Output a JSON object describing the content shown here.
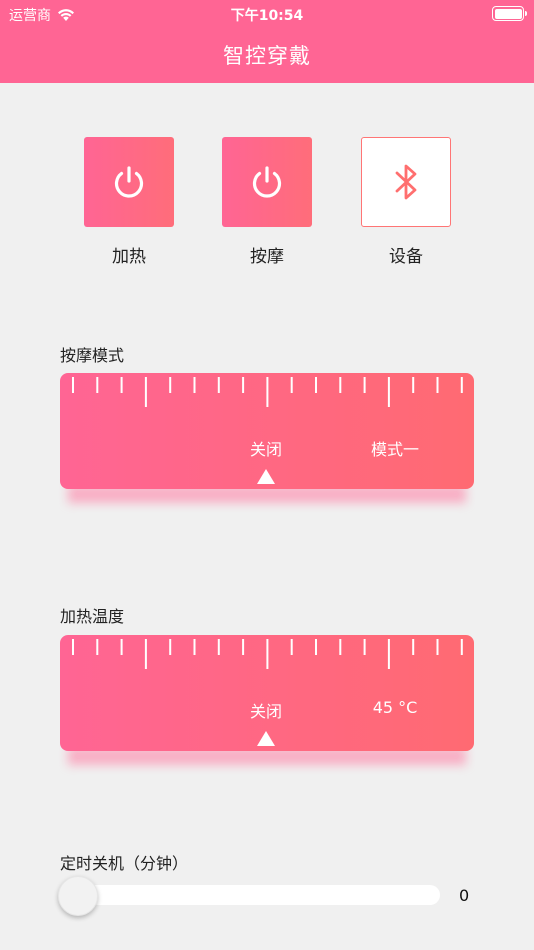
{
  "status_bar": {
    "carrier": "运营商",
    "time": "下午10:54"
  },
  "nav": {
    "title": "智控穿戴"
  },
  "toggles": [
    {
      "label": "加热",
      "icon": "power-icon"
    },
    {
      "label": "按摩",
      "icon": "power-icon"
    },
    {
      "label": "设备",
      "icon": "bluetooth-icon"
    }
  ],
  "massage": {
    "label": "按摩模式",
    "options": [
      "关闭",
      "模式一"
    ]
  },
  "heating": {
    "label": "加热温度",
    "options": [
      "关闭",
      "45 °C"
    ]
  },
  "timer": {
    "label": "定时关机（分钟）",
    "value": "0"
  },
  "colors": {
    "header": "#ff6594",
    "accent_start": "#ff6594",
    "accent_end": "#ff6a72",
    "background": "#f0f0f0"
  }
}
